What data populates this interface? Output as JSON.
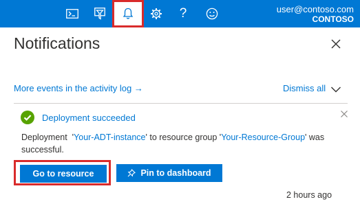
{
  "colors": {
    "accent": "#0078d4",
    "highlight": "#d92b2b",
    "success": "#57a300"
  },
  "topbar": {
    "icons": [
      "cloud-shell-icon",
      "directory-filter-icon",
      "notifications-bell-icon",
      "settings-gear-icon",
      "help-icon",
      "feedback-smiley-icon"
    ],
    "help_glyph": "?",
    "account": {
      "email": "user@contoso.com",
      "tenant": "CONTOSO"
    }
  },
  "panel": {
    "title": "Notifications",
    "activity_log_link": "More events in the activity log →",
    "dismiss_all": "Dismiss all"
  },
  "notification": {
    "title": "Deployment succeeded",
    "body_prefix": "Deployment  '",
    "resource_name": "Your-ADT-instance",
    "body_middle": "' to resource group '",
    "resource_group": "Your-Resource-Group",
    "body_suffix": "' was successful.",
    "primary_button": "Go to resource",
    "secondary_button": "Pin to dashboard",
    "timestamp": "2 hours ago"
  }
}
